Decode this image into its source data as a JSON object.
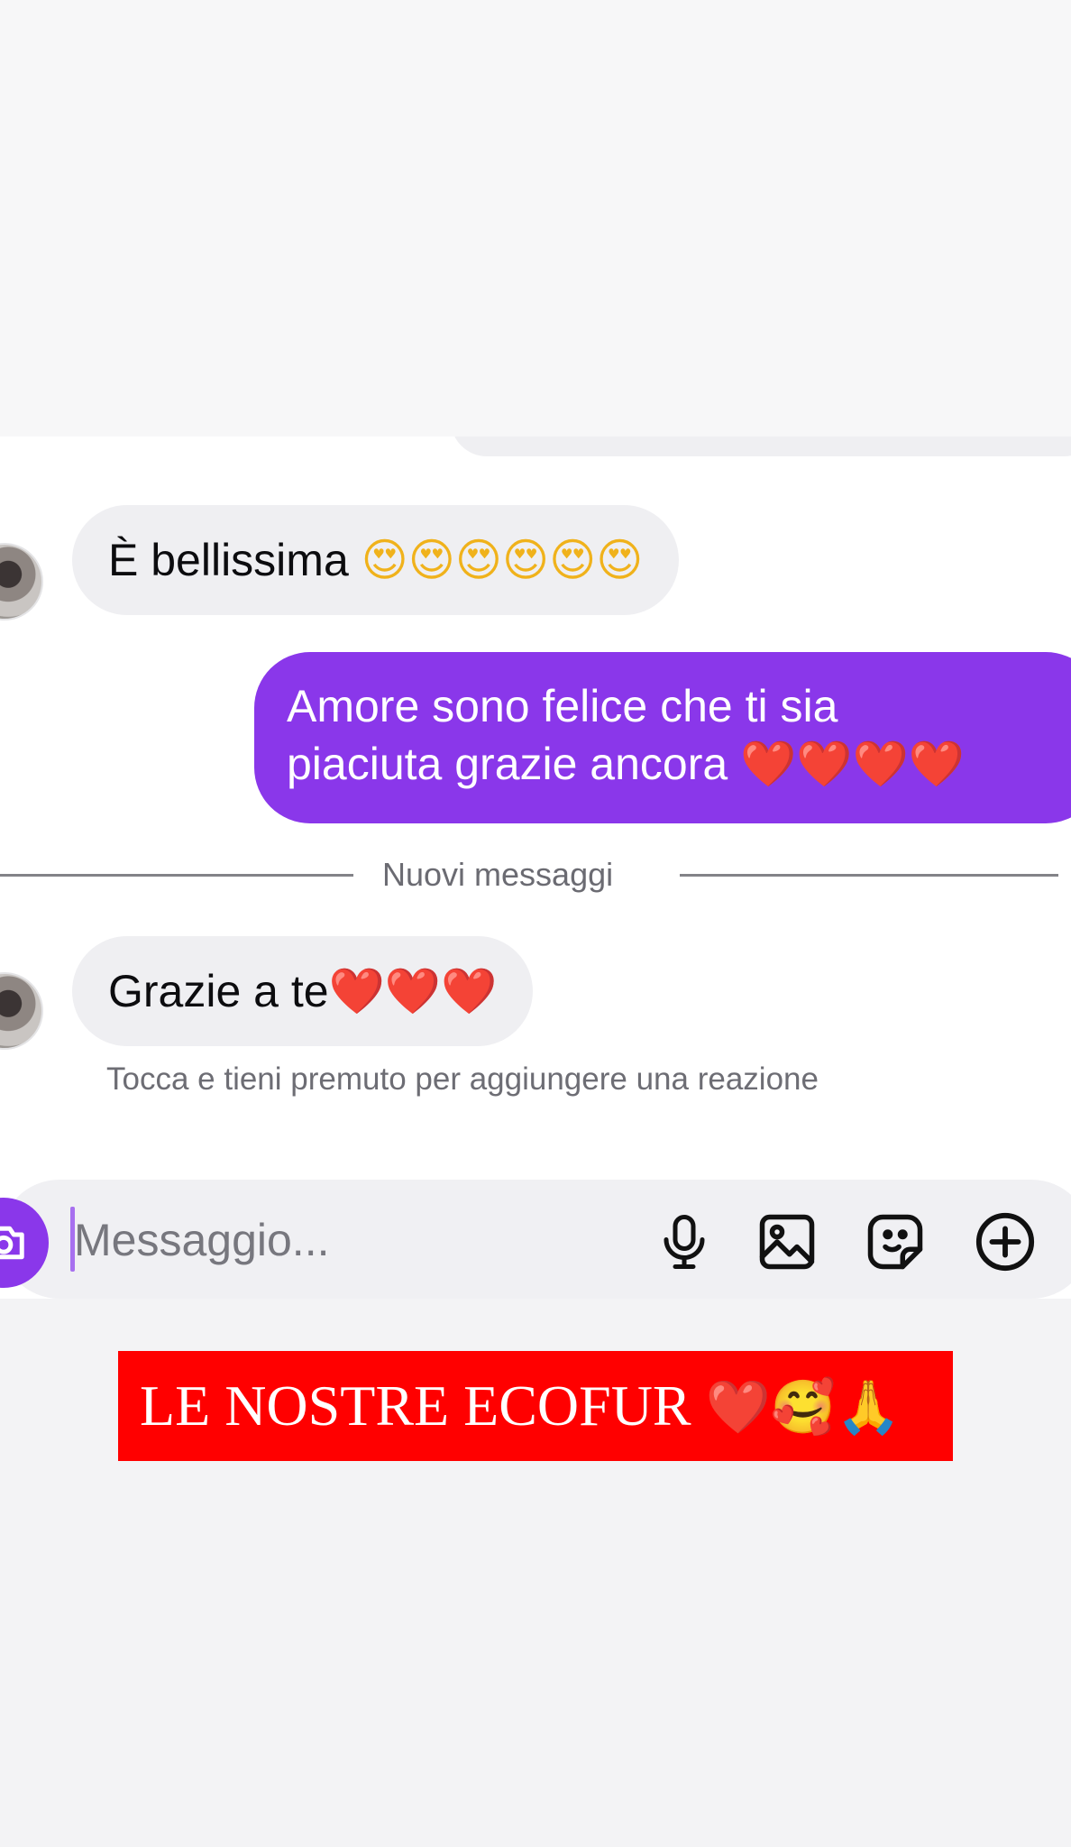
{
  "messages": [
    {
      "direction": "incoming",
      "text": "È bellissima",
      "emojis": "😍😍😍😍😍😍"
    },
    {
      "direction": "outgoing",
      "line1": "Amore sono felice che ti sia",
      "line2": "piaciuta grazie ancora",
      "emojis": "❤️❤️❤️❤️"
    },
    {
      "direction": "incoming",
      "text": "Grazie a te",
      "emojis": "❤️❤️❤️"
    }
  ],
  "divider_label": "Nuovi messaggi",
  "reaction_hint": "Tocca e tieni premuto per aggiungere una reazione",
  "composer": {
    "placeholder": "Messaggio...",
    "icons": [
      "camera-icon",
      "microphone-icon",
      "image-icon",
      "sticker-icon",
      "add-icon"
    ]
  },
  "banner": {
    "text": "LE NOSTRE ECOFUR",
    "emojis": "❤️🥰🙏"
  },
  "colors": {
    "outgoing_bubble": "#8a37ea",
    "incoming_bubble": "#efeff2",
    "banner_background": "#ff0000"
  }
}
